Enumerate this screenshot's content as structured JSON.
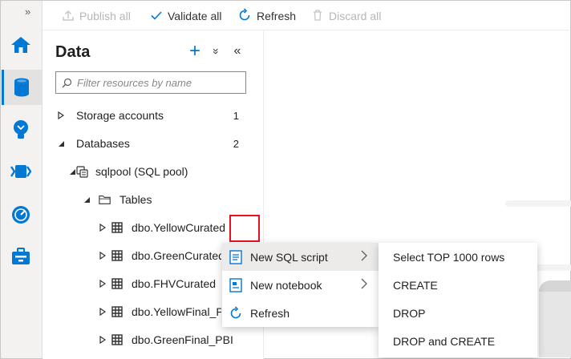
{
  "toolbar": {
    "expand_glyph": "»",
    "publish_all": "Publish all",
    "validate_all": "Validate all",
    "refresh": "Refresh",
    "discard_all": "Discard all"
  },
  "rail": {
    "items": [
      {
        "icon": "home-icon"
      },
      {
        "icon": "database-icon",
        "active": true
      },
      {
        "icon": "develop-icon"
      },
      {
        "icon": "integrate-icon"
      },
      {
        "icon": "monitor-icon"
      },
      {
        "icon": "manage-icon"
      }
    ]
  },
  "panel": {
    "title": "Data",
    "add_glyph": "+",
    "collapse_all_glyph": "»",
    "hide_glyph": "«",
    "search_placeholder": "Filter resources by name"
  },
  "tree": {
    "storage_accounts": {
      "label": "Storage accounts",
      "count": "1"
    },
    "databases": {
      "label": "Databases",
      "count": "2"
    },
    "sqlpool": {
      "label": "sqlpool (SQL pool)"
    },
    "tables": {
      "label": "Tables"
    },
    "items": [
      {
        "label": "dbo.YellowCurated"
      },
      {
        "label": "dbo.GreenCurated"
      },
      {
        "label": "dbo.FHVCurated"
      },
      {
        "label": "dbo.YellowFinal_PBI"
      },
      {
        "label": "dbo.GreenFinal_PBI"
      }
    ]
  },
  "context_menu": {
    "items": [
      {
        "label": "New SQL script",
        "icon": "sql-script-icon",
        "submenu": true
      },
      {
        "label": "New notebook",
        "icon": "notebook-icon",
        "submenu": true
      },
      {
        "label": "Refresh",
        "icon": "refresh-icon",
        "submenu": false
      }
    ]
  },
  "sub_menu": {
    "items": [
      {
        "label": "Select TOP 1000 rows"
      },
      {
        "label": "CREATE"
      },
      {
        "label": "DROP"
      },
      {
        "label": "DROP and CREATE"
      }
    ]
  },
  "colors": {
    "accent": "#0078d4",
    "highlight": "#e81123",
    "rail_bg": "#f3f2f1"
  }
}
